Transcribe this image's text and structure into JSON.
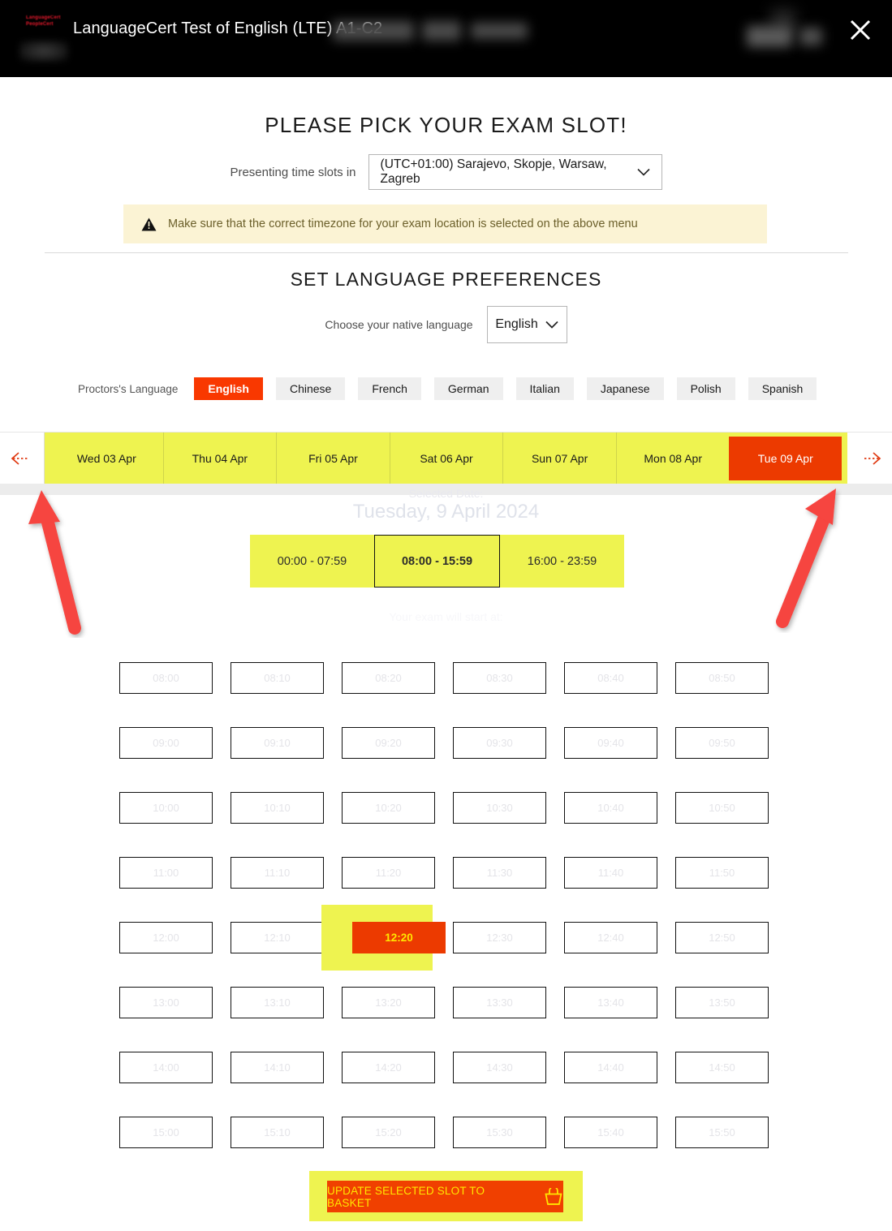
{
  "topbar": {
    "title": "LanguageCert Test of English (LTE) A1-C2",
    "logo_line1": "LanguageCert",
    "logo_line2": "PeopleCert",
    "close_label": "✕"
  },
  "heading": {
    "main": "PLEASE PICK YOUR EXAM SLOT!",
    "language_section": "SET LANGUAGE PREFERENCES"
  },
  "timezone": {
    "label": "Presenting time slots in",
    "selected": "(UTC+01:00) Sarajevo, Skopje, Warsaw, Zagreb"
  },
  "warning": {
    "text": "Make sure that the correct timezone for your exam location is selected on the above menu",
    "icon": "warning-triangle-icon",
    "bg_color": "#fbf3d4"
  },
  "native_language": {
    "label": "Choose your native language",
    "selected": "English"
  },
  "proctor_language": {
    "label": "Proctors's Language",
    "options": [
      {
        "label": "English",
        "active": true
      },
      {
        "label": "Chinese",
        "active": false
      },
      {
        "label": "French",
        "active": false
      },
      {
        "label": "German",
        "active": false
      },
      {
        "label": "Italian",
        "active": false
      },
      {
        "label": "Japanese",
        "active": false
      },
      {
        "label": "Polish",
        "active": false
      },
      {
        "label": "Spanish",
        "active": false
      }
    ],
    "active_color": "#f93800",
    "inactive_color": "#efefef"
  },
  "date_strip": {
    "prev_label": "previous-dates-arrow",
    "next_label": "next-dates-arrow",
    "days": [
      {
        "label": "Wed 03 Apr",
        "selected": false
      },
      {
        "label": "Thu 04 Apr",
        "selected": false
      },
      {
        "label": "Fri 05 Apr",
        "selected": false
      },
      {
        "label": "Sat 06 Apr",
        "selected": false
      },
      {
        "label": "Sun 07 Apr",
        "selected": false
      },
      {
        "label": "Mon 08 Apr",
        "selected": false
      },
      {
        "label": "Tue 09 Apr",
        "selected": true
      }
    ],
    "highlight_color": "#eef350",
    "selected_color": "#ec3a00"
  },
  "selected_date": {
    "caption": "Selected Date:",
    "value": "Tuesday, 9 April 2024"
  },
  "time_ranges": {
    "options": [
      {
        "label": "00:00 - 07:59",
        "active": false
      },
      {
        "label": "08:00 - 15:59",
        "active": true
      },
      {
        "label": "16:00 - 23:59",
        "active": false
      }
    ]
  },
  "start_note": "Your exam will start at:",
  "slots": {
    "selected": "12:20",
    "rows": [
      [
        "08:00",
        "08:10",
        "08:20",
        "08:30",
        "08:40",
        "08:50"
      ],
      [
        "09:00",
        "09:10",
        "09:20",
        "09:30",
        "09:40",
        "09:50"
      ],
      [
        "10:00",
        "10:10",
        "10:20",
        "10:30",
        "10:40",
        "10:50"
      ],
      [
        "11:00",
        "11:10",
        "11:20",
        "11:30",
        "11:40",
        "11:50"
      ],
      [
        "12:00",
        "12:10",
        "12:20",
        "12:30",
        "12:40",
        "12:50"
      ],
      [
        "13:00",
        "13:10",
        "13:20",
        "13:30",
        "13:40",
        "13:50"
      ],
      [
        "14:00",
        "14:10",
        "14:20",
        "14:30",
        "14:40",
        "14:50"
      ],
      [
        "15:00",
        "15:10",
        "15:20",
        "15:30",
        "15:40",
        "15:50"
      ]
    ]
  },
  "basket": {
    "label": "UPDATE SELECTED SLOT TO BASKET",
    "icon": "shopping-basket-icon",
    "bg_color": "#f04000",
    "text_color": "#ffe600"
  }
}
